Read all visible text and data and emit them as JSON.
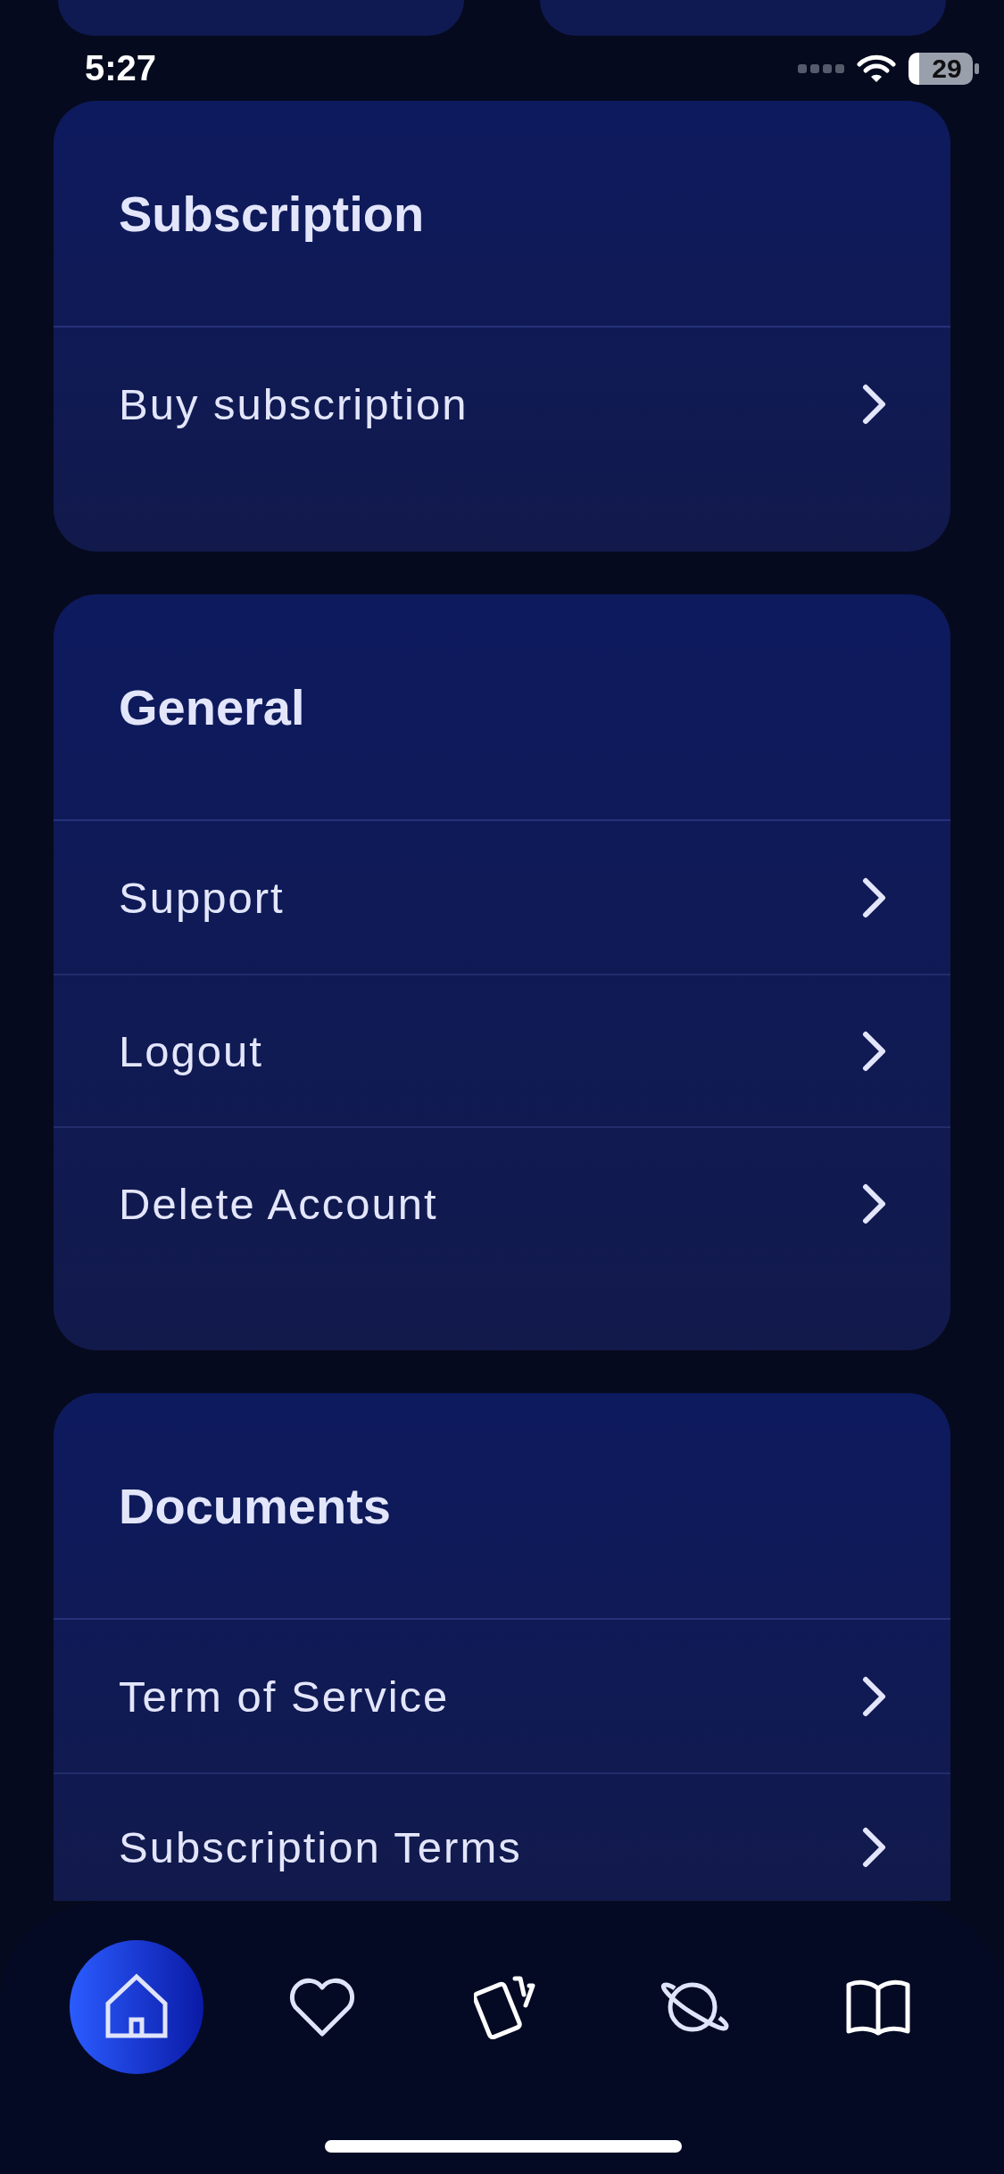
{
  "status_bar": {
    "time": "5:27",
    "battery": "29"
  },
  "sections": [
    {
      "title": "Subscription",
      "items": [
        {
          "label": "Buy subscription"
        }
      ]
    },
    {
      "title": "General",
      "items": [
        {
          "label": "Support"
        },
        {
          "label": "Logout"
        },
        {
          "label": "Delete Account"
        }
      ]
    },
    {
      "title": "Documents",
      "items": [
        {
          "label": "Term of Service"
        },
        {
          "label": "Subscription Terms"
        }
      ]
    }
  ],
  "tab_bar": [
    {
      "kind": "home",
      "selected": true
    },
    {
      "kind": "heart",
      "selected": false
    },
    {
      "kind": "cards",
      "selected": false
    },
    {
      "kind": "planet",
      "selected": false
    },
    {
      "kind": "book",
      "selected": false
    }
  ]
}
